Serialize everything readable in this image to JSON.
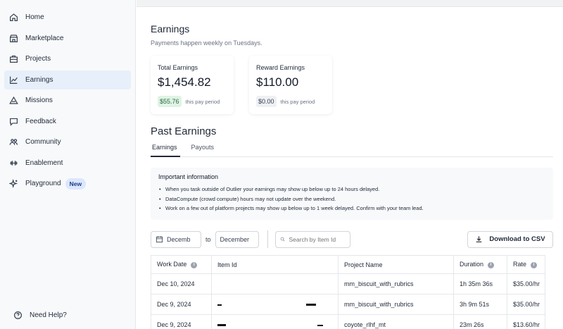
{
  "sidebar": {
    "items": [
      {
        "label": "Home",
        "icon": "home-icon"
      },
      {
        "label": "Marketplace",
        "icon": "store-icon"
      },
      {
        "label": "Projects",
        "icon": "briefcase-icon"
      },
      {
        "label": "Earnings",
        "icon": "chart-line-icon",
        "active": true
      },
      {
        "label": "Missions",
        "icon": "triangle-icon"
      },
      {
        "label": "Feedback",
        "icon": "chat-icon"
      },
      {
        "label": "Community",
        "icon": "people-icon"
      },
      {
        "label": "Enablement",
        "icon": "dumbbell-icon"
      },
      {
        "label": "Playground",
        "icon": "sparkles-icon",
        "badge": "New"
      }
    ],
    "help": "Need Help?"
  },
  "earnings": {
    "title": "Earnings",
    "subtitle": "Payments happen weekly on Tuesdays.",
    "total": {
      "label": "Total Earnings",
      "amount": "$1,454.82",
      "period_amount": "$55.76",
      "period_label": "this pay period"
    },
    "reward": {
      "label": "Reward Earnings",
      "amount": "$110.00",
      "period_amount": "$0.00",
      "period_label": "this pay period"
    }
  },
  "past": {
    "title": "Past Earnings",
    "tabs": [
      "Earnings",
      "Payouts"
    ],
    "info_title": "Important information",
    "info_items": [
      "When you task outside of Outlier your earnings may show up below up to 24 hours delayed.",
      "DataCompute (crowd compute) hours may not update over the weekend.",
      "Work on a few out of platform projects may show up below up to 1 week delayed. Confirm with your team lead."
    ]
  },
  "filters": {
    "from_value": "Decemb",
    "to_label": "to",
    "to_value": "December",
    "search_placeholder": "Search by Item Id",
    "download_label": "Download to CSV"
  },
  "table": {
    "columns": [
      "Work Date",
      "Item Id",
      "Project Name",
      "Duration",
      "Rate"
    ],
    "rows": [
      {
        "date": "Dec 10, 2024",
        "project": "mm_biscuit_with_rubrics",
        "duration": "1h 35m 36s",
        "rate": "$35.00/hr"
      },
      {
        "date": "Dec 9, 2024",
        "project": "mm_biscuit_with_rubrics",
        "duration": "3h 9m 51s",
        "rate": "$35.00/hr"
      },
      {
        "date": "Dec 9, 2024",
        "project": "coyote_rlhf_mt",
        "duration": "23m 26s",
        "rate": "$13.60/hr"
      }
    ]
  },
  "colors": {
    "active_nav": "#e7effa",
    "green_pill": "#dff3e5",
    "badge": "#dbe7fb"
  }
}
